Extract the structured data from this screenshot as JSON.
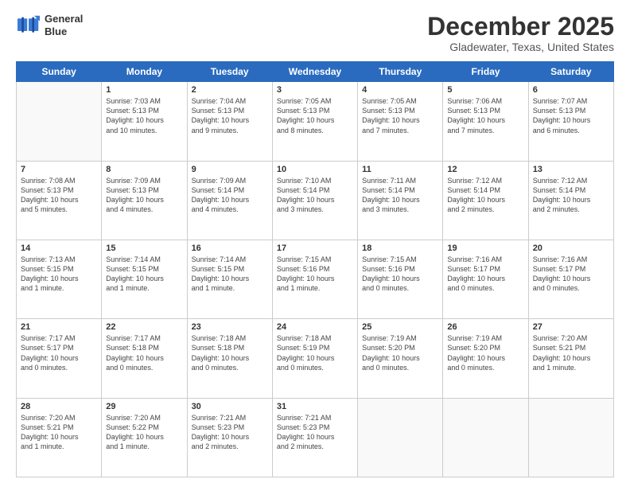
{
  "header": {
    "logo_line1": "General",
    "logo_line2": "Blue",
    "month": "December 2025",
    "location": "Gladewater, Texas, United States"
  },
  "weekdays": [
    "Sunday",
    "Monday",
    "Tuesday",
    "Wednesday",
    "Thursday",
    "Friday",
    "Saturday"
  ],
  "weeks": [
    [
      {
        "day": "",
        "info": ""
      },
      {
        "day": "1",
        "info": "Sunrise: 7:03 AM\nSunset: 5:13 PM\nDaylight: 10 hours\nand 10 minutes."
      },
      {
        "day": "2",
        "info": "Sunrise: 7:04 AM\nSunset: 5:13 PM\nDaylight: 10 hours\nand 9 minutes."
      },
      {
        "day": "3",
        "info": "Sunrise: 7:05 AM\nSunset: 5:13 PM\nDaylight: 10 hours\nand 8 minutes."
      },
      {
        "day": "4",
        "info": "Sunrise: 7:05 AM\nSunset: 5:13 PM\nDaylight: 10 hours\nand 7 minutes."
      },
      {
        "day": "5",
        "info": "Sunrise: 7:06 AM\nSunset: 5:13 PM\nDaylight: 10 hours\nand 7 minutes."
      },
      {
        "day": "6",
        "info": "Sunrise: 7:07 AM\nSunset: 5:13 PM\nDaylight: 10 hours\nand 6 minutes."
      }
    ],
    [
      {
        "day": "7",
        "info": "Sunrise: 7:08 AM\nSunset: 5:13 PM\nDaylight: 10 hours\nand 5 minutes."
      },
      {
        "day": "8",
        "info": "Sunrise: 7:09 AM\nSunset: 5:13 PM\nDaylight: 10 hours\nand 4 minutes."
      },
      {
        "day": "9",
        "info": "Sunrise: 7:09 AM\nSunset: 5:14 PM\nDaylight: 10 hours\nand 4 minutes."
      },
      {
        "day": "10",
        "info": "Sunrise: 7:10 AM\nSunset: 5:14 PM\nDaylight: 10 hours\nand 3 minutes."
      },
      {
        "day": "11",
        "info": "Sunrise: 7:11 AM\nSunset: 5:14 PM\nDaylight: 10 hours\nand 3 minutes."
      },
      {
        "day": "12",
        "info": "Sunrise: 7:12 AM\nSunset: 5:14 PM\nDaylight: 10 hours\nand 2 minutes."
      },
      {
        "day": "13",
        "info": "Sunrise: 7:12 AM\nSunset: 5:14 PM\nDaylight: 10 hours\nand 2 minutes."
      }
    ],
    [
      {
        "day": "14",
        "info": "Sunrise: 7:13 AM\nSunset: 5:15 PM\nDaylight: 10 hours\nand 1 minute."
      },
      {
        "day": "15",
        "info": "Sunrise: 7:14 AM\nSunset: 5:15 PM\nDaylight: 10 hours\nand 1 minute."
      },
      {
        "day": "16",
        "info": "Sunrise: 7:14 AM\nSunset: 5:15 PM\nDaylight: 10 hours\nand 1 minute."
      },
      {
        "day": "17",
        "info": "Sunrise: 7:15 AM\nSunset: 5:16 PM\nDaylight: 10 hours\nand 1 minute."
      },
      {
        "day": "18",
        "info": "Sunrise: 7:15 AM\nSunset: 5:16 PM\nDaylight: 10 hours\nand 0 minutes."
      },
      {
        "day": "19",
        "info": "Sunrise: 7:16 AM\nSunset: 5:17 PM\nDaylight: 10 hours\nand 0 minutes."
      },
      {
        "day": "20",
        "info": "Sunrise: 7:16 AM\nSunset: 5:17 PM\nDaylight: 10 hours\nand 0 minutes."
      }
    ],
    [
      {
        "day": "21",
        "info": "Sunrise: 7:17 AM\nSunset: 5:17 PM\nDaylight: 10 hours\nand 0 minutes."
      },
      {
        "day": "22",
        "info": "Sunrise: 7:17 AM\nSunset: 5:18 PM\nDaylight: 10 hours\nand 0 minutes."
      },
      {
        "day": "23",
        "info": "Sunrise: 7:18 AM\nSunset: 5:18 PM\nDaylight: 10 hours\nand 0 minutes."
      },
      {
        "day": "24",
        "info": "Sunrise: 7:18 AM\nSunset: 5:19 PM\nDaylight: 10 hours\nand 0 minutes."
      },
      {
        "day": "25",
        "info": "Sunrise: 7:19 AM\nSunset: 5:20 PM\nDaylight: 10 hours\nand 0 minutes."
      },
      {
        "day": "26",
        "info": "Sunrise: 7:19 AM\nSunset: 5:20 PM\nDaylight: 10 hours\nand 0 minutes."
      },
      {
        "day": "27",
        "info": "Sunrise: 7:20 AM\nSunset: 5:21 PM\nDaylight: 10 hours\nand 1 minute."
      }
    ],
    [
      {
        "day": "28",
        "info": "Sunrise: 7:20 AM\nSunset: 5:21 PM\nDaylight: 10 hours\nand 1 minute."
      },
      {
        "day": "29",
        "info": "Sunrise: 7:20 AM\nSunset: 5:22 PM\nDaylight: 10 hours\nand 1 minute."
      },
      {
        "day": "30",
        "info": "Sunrise: 7:21 AM\nSunset: 5:23 PM\nDaylight: 10 hours\nand 2 minutes."
      },
      {
        "day": "31",
        "info": "Sunrise: 7:21 AM\nSunset: 5:23 PM\nDaylight: 10 hours\nand 2 minutes."
      },
      {
        "day": "",
        "info": ""
      },
      {
        "day": "",
        "info": ""
      },
      {
        "day": "",
        "info": ""
      }
    ]
  ]
}
